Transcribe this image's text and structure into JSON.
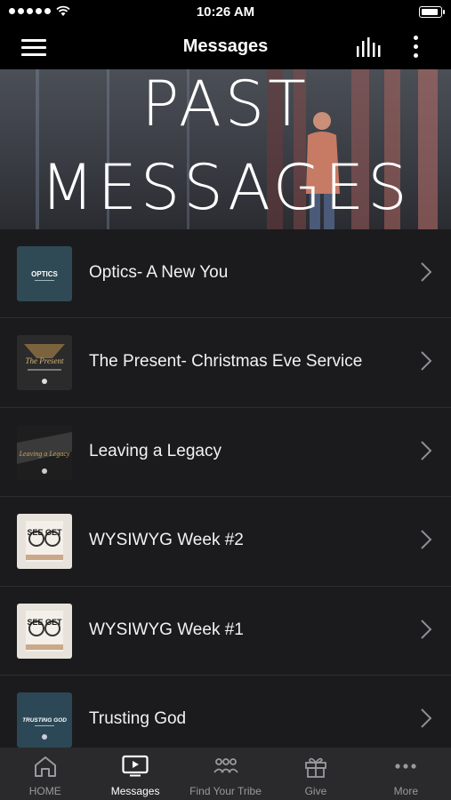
{
  "status_bar": {
    "time": "10:26 AM"
  },
  "nav": {
    "title": "Messages"
  },
  "banner": {
    "line1": "PAST",
    "line2": "MESSAGES"
  },
  "messages": [
    {
      "title": "Optics- A New You",
      "thumb_text": "OPTICS",
      "thumb_style": "teal"
    },
    {
      "title": "The Present- Christmas Eve Service",
      "thumb_text": "The Present",
      "thumb_style": "gold"
    },
    {
      "title": "Leaving a Legacy",
      "thumb_text": "Leaving a Legacy",
      "thumb_style": "dark-gold"
    },
    {
      "title": "WYSIWYG Week #2",
      "thumb_text": "SEE GET",
      "thumb_style": "light"
    },
    {
      "title": "WYSIWYG Week #1",
      "thumb_text": "SEE GET",
      "thumb_style": "light"
    },
    {
      "title": "Trusting God",
      "thumb_text": "TRUSTING GOD",
      "thumb_style": "teal"
    }
  ],
  "tabs": [
    {
      "label": "HOME",
      "icon": "home-icon",
      "active": false
    },
    {
      "label": "Messages",
      "icon": "tv-play-icon",
      "active": true
    },
    {
      "label": "Find Your Tribe",
      "icon": "group-icon",
      "active": false
    },
    {
      "label": "Give",
      "icon": "gift-icon",
      "active": false
    },
    {
      "label": "More",
      "icon": "more-dots-icon",
      "active": false
    }
  ],
  "colors": {
    "background": "#000000",
    "list_background": "#1b1b1d",
    "tab_bar": "#2a2a2c",
    "inactive_tab": "#9a9a9e"
  }
}
